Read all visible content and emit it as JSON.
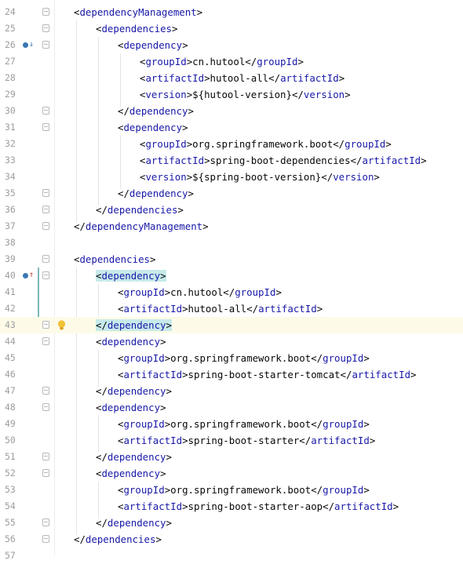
{
  "colors": {
    "tag": "#1818a8",
    "text": "#080808",
    "line_number": "#9d9d9d",
    "current_line": "#fdfbe8",
    "match_highlight": "#c7eaea"
  },
  "lines": [
    {
      "n": "24",
      "indent": 0,
      "type": "open",
      "tag": "dependencyManagement",
      "fold": true
    },
    {
      "n": "25",
      "indent": 1,
      "type": "open",
      "tag": "dependencies",
      "fold": true
    },
    {
      "n": "26",
      "indent": 2,
      "type": "open",
      "tag": "dependency",
      "fold": true,
      "gutter_icon": "implemented-down-icon"
    },
    {
      "n": "27",
      "indent": 3,
      "type": "element",
      "tag": "groupId",
      "text": "cn.hutool"
    },
    {
      "n": "28",
      "indent": 3,
      "type": "element",
      "tag": "artifactId",
      "text": "hutool-all"
    },
    {
      "n": "29",
      "indent": 3,
      "type": "element",
      "tag": "version",
      "text": "${hutool-version}"
    },
    {
      "n": "30",
      "indent": 2,
      "type": "close",
      "tag": "dependency",
      "fold": true
    },
    {
      "n": "31",
      "indent": 2,
      "type": "open",
      "tag": "dependency",
      "fold": true
    },
    {
      "n": "32",
      "indent": 3,
      "type": "element",
      "tag": "groupId",
      "text": "org.springframework.boot"
    },
    {
      "n": "33",
      "indent": 3,
      "type": "element",
      "tag": "artifactId",
      "text": "spring-boot-dependencies"
    },
    {
      "n": "34",
      "indent": 3,
      "type": "element",
      "tag": "version",
      "text": "${spring-boot-version}"
    },
    {
      "n": "35",
      "indent": 2,
      "type": "close",
      "tag": "dependency",
      "fold": true
    },
    {
      "n": "36",
      "indent": 1,
      "type": "close",
      "tag": "dependencies",
      "fold": true
    },
    {
      "n": "37",
      "indent": 0,
      "type": "close",
      "tag": "dependencyManagement",
      "fold": true
    },
    {
      "n": "38",
      "indent": 0,
      "type": "blank"
    },
    {
      "n": "39",
      "indent": 0,
      "type": "open",
      "tag": "dependencies",
      "fold": true
    },
    {
      "n": "40",
      "indent": 1,
      "type": "open",
      "tag": "dependency",
      "fold": true,
      "highlight": true,
      "gutter_icon": "implemented-up-icon"
    },
    {
      "n": "41",
      "indent": 2,
      "type": "element",
      "tag": "groupId",
      "text": "cn.hutool"
    },
    {
      "n": "42",
      "indent": 2,
      "type": "element",
      "tag": "artifactId",
      "text": "hutool-all"
    },
    {
      "n": "43",
      "indent": 1,
      "type": "close",
      "tag": "dependency",
      "fold": true,
      "highlight": true,
      "current": true,
      "bulb": true
    },
    {
      "n": "44",
      "indent": 1,
      "type": "open",
      "tag": "dependency",
      "fold": true
    },
    {
      "n": "45",
      "indent": 2,
      "type": "element",
      "tag": "groupId",
      "text": "org.springframework.boot"
    },
    {
      "n": "46",
      "indent": 2,
      "type": "element",
      "tag": "artifactId",
      "text": "spring-boot-starter-tomcat"
    },
    {
      "n": "47",
      "indent": 1,
      "type": "close",
      "tag": "dependency",
      "fold": true
    },
    {
      "n": "48",
      "indent": 1,
      "type": "open",
      "tag": "dependency",
      "fold": true
    },
    {
      "n": "49",
      "indent": 2,
      "type": "element",
      "tag": "groupId",
      "text": "org.springframework.boot"
    },
    {
      "n": "50",
      "indent": 2,
      "type": "element",
      "tag": "artifactId",
      "text": "spring-boot-starter"
    },
    {
      "n": "51",
      "indent": 1,
      "type": "close",
      "tag": "dependency",
      "fold": true
    },
    {
      "n": "52",
      "indent": 1,
      "type": "open",
      "tag": "dependency",
      "fold": true
    },
    {
      "n": "53",
      "indent": 2,
      "type": "element",
      "tag": "groupId",
      "text": "org.springframework.boot"
    },
    {
      "n": "54",
      "indent": 2,
      "type": "element",
      "tag": "artifactId",
      "text": "spring-boot-starter-aop"
    },
    {
      "n": "55",
      "indent": 1,
      "type": "close",
      "tag": "dependency",
      "fold": true
    },
    {
      "n": "56",
      "indent": 0,
      "type": "close",
      "tag": "dependencies",
      "fold": true
    },
    {
      "n": "57",
      "indent": 0,
      "type": "blank"
    }
  ]
}
